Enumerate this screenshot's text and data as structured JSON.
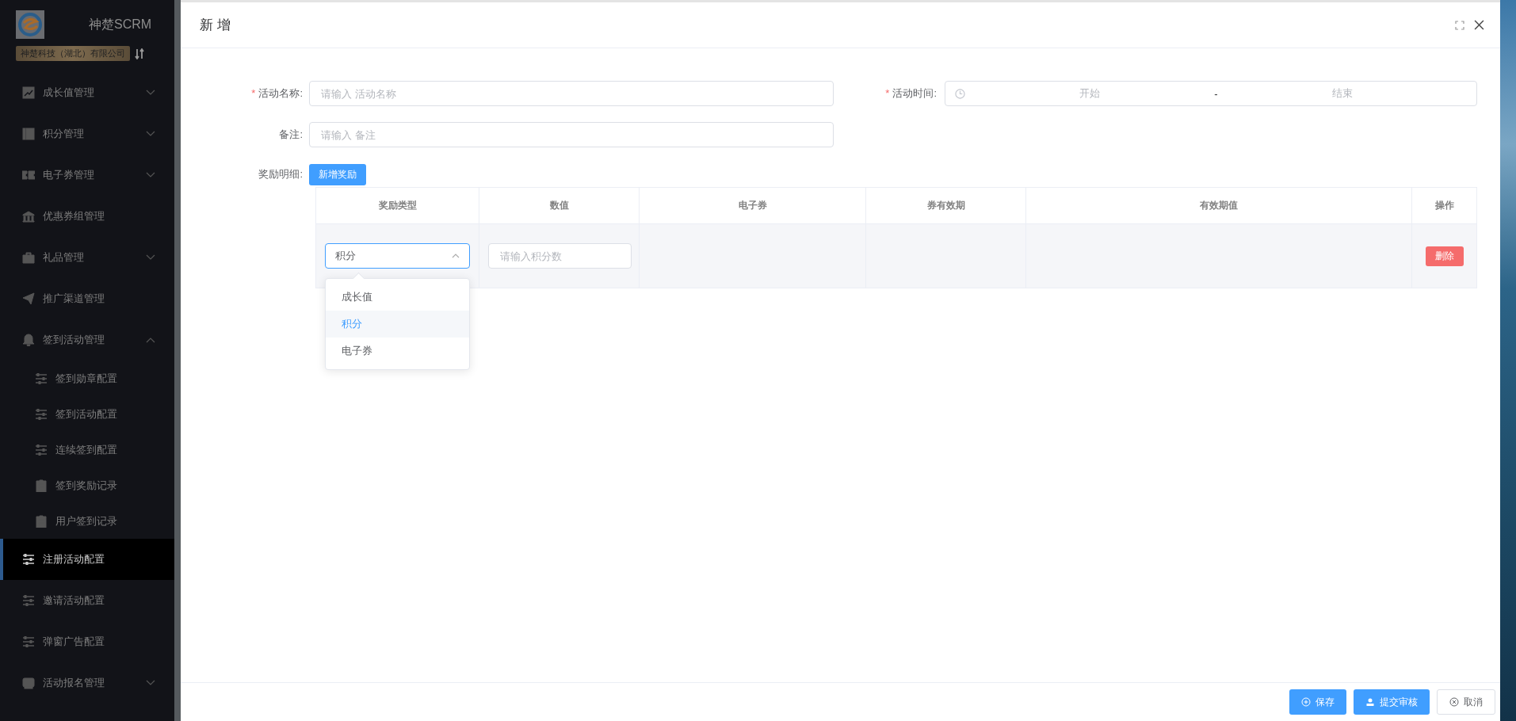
{
  "sidebar": {
    "brand": "神楚SCRM",
    "company": "神楚科技（湖北）有限公司",
    "items": [
      {
        "label": "成长值管理",
        "kind": "group",
        "expanded": false,
        "selected": false
      },
      {
        "label": "积分管理",
        "kind": "group",
        "expanded": false,
        "selected": false
      },
      {
        "label": "电子券管理",
        "kind": "group",
        "expanded": false,
        "selected": false
      },
      {
        "label": "优惠券组管理",
        "kind": "link",
        "selected": false
      },
      {
        "label": "礼品管理",
        "kind": "group",
        "expanded": false,
        "selected": false
      },
      {
        "label": "推广渠道管理",
        "kind": "link",
        "selected": false
      },
      {
        "label": "签到活动管理",
        "kind": "group",
        "expanded": true,
        "selected": false,
        "children": [
          {
            "label": "签到勋章配置",
            "selected": false
          },
          {
            "label": "签到活动配置",
            "selected": false
          },
          {
            "label": "连续签到配置",
            "selected": false
          },
          {
            "label": "签到奖励记录",
            "selected": false
          },
          {
            "label": "用户签到记录",
            "selected": false
          }
        ]
      },
      {
        "label": "注册活动配置",
        "kind": "link",
        "selected": true
      },
      {
        "label": "邀请活动配置",
        "kind": "link",
        "selected": false
      },
      {
        "label": "弹窗广告配置",
        "kind": "link",
        "selected": false
      },
      {
        "label": "活动报名管理",
        "kind": "group",
        "expanded": false,
        "selected": false
      }
    ]
  },
  "dialog": {
    "title": "新 增",
    "name_field": {
      "label": "活动名称:",
      "required": true,
      "required_mark": "*",
      "placeholder": "请输入 活动名称"
    },
    "time_field": {
      "label": "活动时间:",
      "required": true,
      "required_mark": "*",
      "start": "开始",
      "separator": "-",
      "end": "结束"
    },
    "remark_field": {
      "label": "备注:",
      "placeholder": "请输入 备注"
    },
    "reward": {
      "label": "奖励明细:",
      "add_button": "新增奖励",
      "columns": [
        "奖励类型",
        "数值",
        "电子券",
        "券有效期",
        "有效期值",
        "操作"
      ],
      "rows": [
        {
          "type": "积分",
          "open": true,
          "amount_placeholder": "请输入积分数",
          "delete": "删除",
          "options": [
            {
              "label": "成长值",
              "selected": false
            },
            {
              "label": "积分",
              "selected": true
            },
            {
              "label": "电子券",
              "selected": false
            }
          ]
        }
      ]
    },
    "footer": [
      {
        "label": "保存",
        "kind": "primary"
      },
      {
        "label": "提交审核",
        "kind": "primary"
      },
      {
        "label": "取消",
        "kind": "default"
      }
    ]
  }
}
